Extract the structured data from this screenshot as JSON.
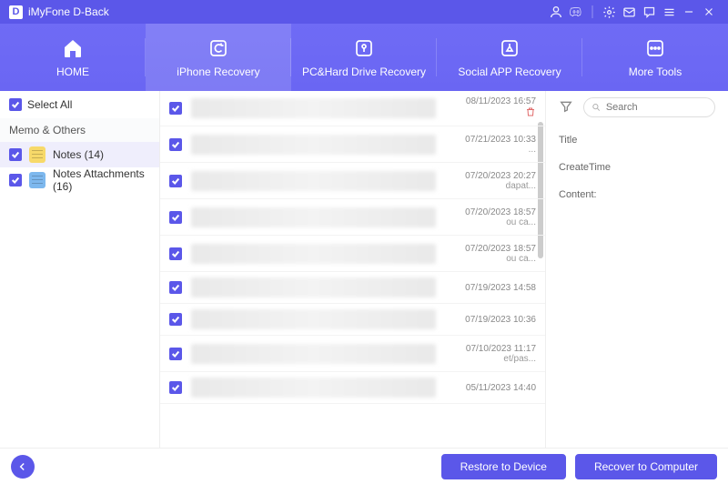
{
  "window": {
    "title": "iMyFone D-Back",
    "logo_letter": "D"
  },
  "nav": {
    "items": [
      {
        "label": "HOME"
      },
      {
        "label": "iPhone Recovery"
      },
      {
        "label": "PC&Hard Drive Recovery"
      },
      {
        "label": "Social APP Recovery"
      },
      {
        "label": "More Tools"
      }
    ],
    "active_index": 1
  },
  "sidebar": {
    "select_all_label": "Select All",
    "group_label": "Memo & Others",
    "items": [
      {
        "label": "Notes (14)",
        "active": true,
        "icon": "yellow"
      },
      {
        "label": "Notes Attachments (16)",
        "active": false,
        "icon": "blue"
      }
    ]
  },
  "search": {
    "placeholder": "Search"
  },
  "list": [
    {
      "date": "08/11/2023 16:57",
      "snippet": "",
      "deleted": true
    },
    {
      "date": "07/21/2023 10:33",
      "snippet": "..."
    },
    {
      "date": "07/20/2023 20:27",
      "snippet": "dapat..."
    },
    {
      "date": "07/20/2023 18:57",
      "snippet": "ou ca..."
    },
    {
      "date": "07/20/2023 18:57",
      "snippet": "ou ca..."
    },
    {
      "date": "07/19/2023 14:58",
      "snippet": ""
    },
    {
      "date": "07/19/2023 10:36",
      "snippet": ""
    },
    {
      "date": "07/10/2023 11:17",
      "snippet": "et/pas..."
    },
    {
      "date": "05/11/2023 14:40",
      "snippet": ""
    }
  ],
  "detail": {
    "title_label": "Title",
    "createtime_label": "CreateTime",
    "content_label": "Content:"
  },
  "footer": {
    "restore_label": "Restore to Device",
    "recover_label": "Recover to Computer"
  }
}
